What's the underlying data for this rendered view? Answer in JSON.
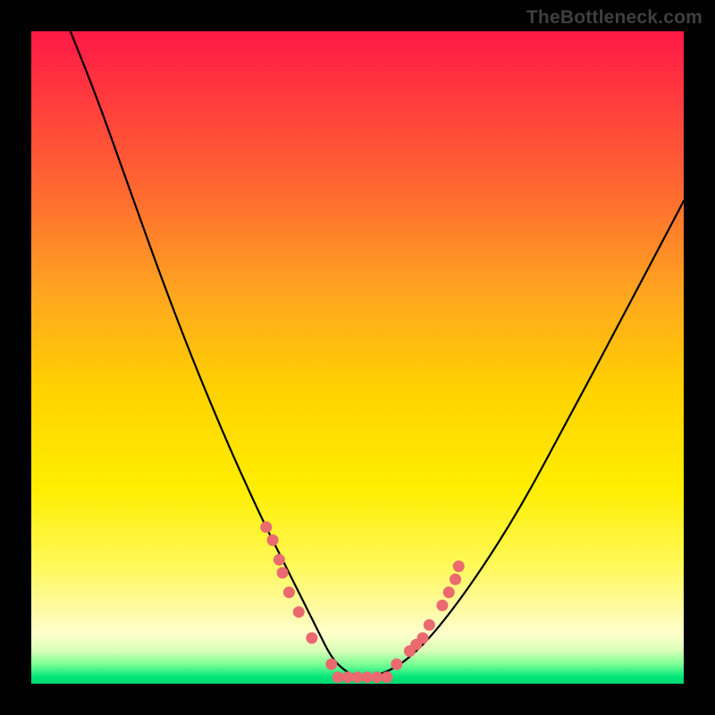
{
  "attribution": "TheBottleneck.com",
  "chart_data": {
    "type": "line",
    "title": "",
    "xlabel": "",
    "ylabel": "",
    "xlim": [
      0,
      100
    ],
    "ylim": [
      0,
      100
    ],
    "series": [
      {
        "name": "curve",
        "x": [
          6,
          10,
          15,
          20,
          25,
          30,
          35,
          38,
          40,
          42,
          44,
          46,
          48,
          50,
          52,
          55,
          58,
          62,
          68,
          75,
          82,
          90,
          100
        ],
        "y": [
          100,
          90,
          76,
          62,
          49,
          37,
          26,
          20,
          16,
          12,
          8,
          4,
          2,
          1,
          1,
          2,
          4,
          8,
          16,
          27,
          40,
          55,
          74
        ]
      }
    ],
    "markers": {
      "left_cluster_x": [
        36,
        37,
        38,
        38.5,
        39.5,
        41,
        43,
        46
      ],
      "left_cluster_y": [
        24,
        22,
        19,
        17,
        14,
        11,
        7,
        3
      ],
      "right_cluster_x": [
        56,
        58,
        59,
        60,
        61,
        63,
        64,
        65,
        65.5
      ],
      "right_cluster_y": [
        3,
        5,
        6,
        7,
        9,
        12,
        14,
        16,
        18
      ],
      "bottom_band_x": [
        47,
        48.5,
        50,
        51.5,
        53,
        54.5
      ],
      "bottom_band_y": [
        1,
        1,
        1,
        1,
        1,
        1
      ]
    },
    "gradient_stops": [
      {
        "pos": 0,
        "color": "#ff1846"
      },
      {
        "pos": 25,
        "color": "#ff6b30"
      },
      {
        "pos": 55,
        "color": "#ffd200"
      },
      {
        "pos": 85,
        "color": "#fffaa8"
      },
      {
        "pos": 97,
        "color": "#7cff95"
      },
      {
        "pos": 100,
        "color": "#00d870"
      }
    ]
  }
}
